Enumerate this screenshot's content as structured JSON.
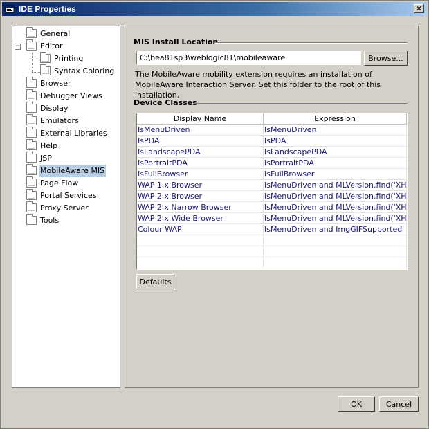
{
  "window": {
    "title": "IDE Properties",
    "close_glyph": "✕"
  },
  "tree": {
    "items": [
      {
        "label": "General"
      },
      {
        "label": "Editor",
        "expander": "−"
      },
      {
        "label": "Printing"
      },
      {
        "label": "Syntax Coloring"
      },
      {
        "label": "Browser"
      },
      {
        "label": "Debugger Views"
      },
      {
        "label": "Display"
      },
      {
        "label": "Emulators"
      },
      {
        "label": "External Libraries"
      },
      {
        "label": "Help"
      },
      {
        "label": "JSP"
      },
      {
        "label": "MobileAware MIS"
      },
      {
        "label": "Page Flow"
      },
      {
        "label": "Portal Services"
      },
      {
        "label": "Proxy Server"
      },
      {
        "label": "Tools"
      }
    ],
    "selected": "MobileAware MIS"
  },
  "install": {
    "section_title": "MIS Install Location",
    "path_value": "C:\\bea81sp3\\weblogic81\\mobileaware",
    "browse_label": "Browse...",
    "description_line1": "The MobileAware mobility extension requires an installation of",
    "description_line2": "MobileAware Interaction Server. Set this folder to the root of this installation."
  },
  "device_classes": {
    "section_title": "Device Classes",
    "columns": [
      "Display Name",
      "Expression"
    ],
    "rows": [
      [
        "IsMenuDriven",
        "IsMenuDriven"
      ],
      [
        "IsPDA",
        "IsPDA"
      ],
      [
        "IsLandscapePDA",
        "IsLandscapePDA"
      ],
      [
        "IsPortraitPDA",
        "IsPortraitPDA"
      ],
      [
        "IsFullBrowser",
        "IsFullBrowser"
      ],
      [
        "WAP 1.x Browser",
        "IsMenuDriven and MLVersion.find('XHTM..."
      ],
      [
        "WAP 2.x Browser",
        "IsMenuDriven and MLVersion.find('XHTM..."
      ],
      [
        "WAP 2.x Narrow Browser",
        "IsMenuDriven and MLVersion.find('XHTM..."
      ],
      [
        "WAP 2.x Wide Browser",
        "IsMenuDriven and MLVersion.find('XHTM..."
      ],
      [
        "Colour WAP",
        "IsMenuDriven and ImgGIFSupported"
      ]
    ],
    "defaults_label": "Defaults"
  },
  "footer": {
    "ok_label": "OK",
    "cancel_label": "Cancel"
  },
  "colors": {
    "titlebar_start": "#0a246a",
    "titlebar_end": "#a6caf0",
    "dialog_bg": "#d4d0c8",
    "selection": "#b8cce4",
    "cell_text": "#1a1a7a"
  }
}
